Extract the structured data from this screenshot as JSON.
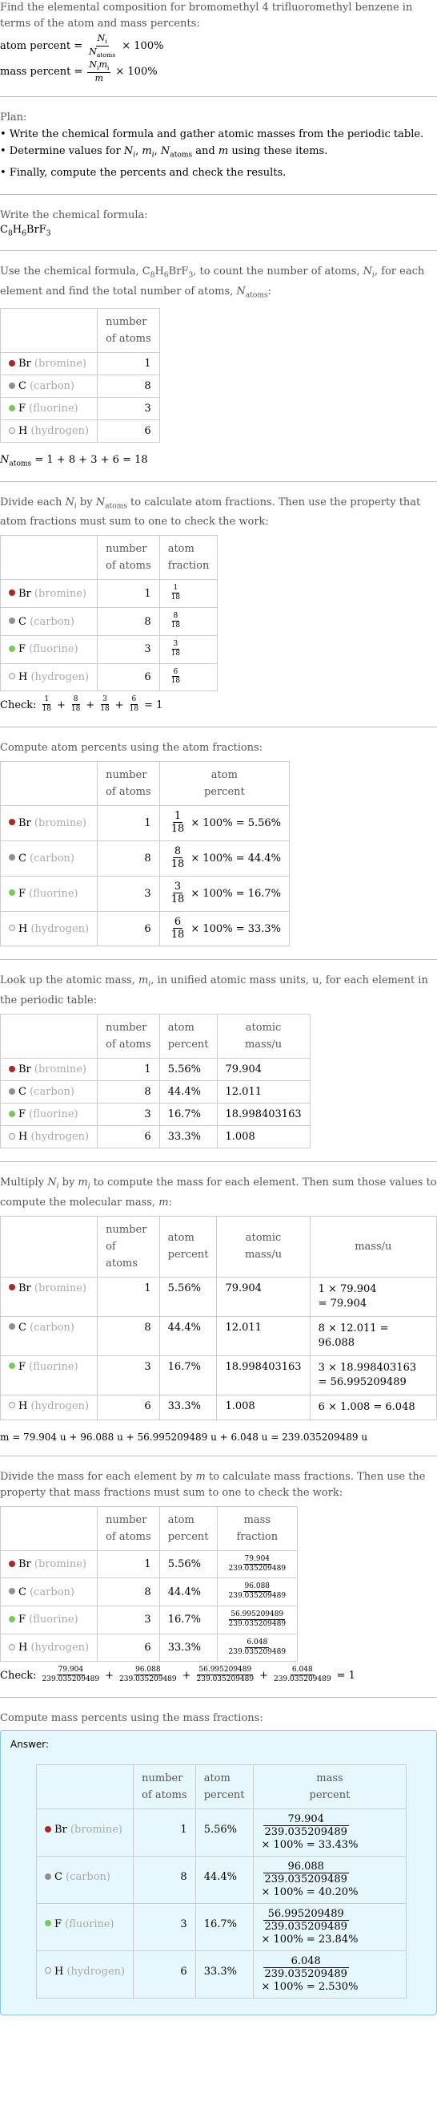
{
  "intro": {
    "text": "Find the elemental composition for bromomethyl 4 trifluoromethyl benzene in terms of the atom and mass percents:",
    "atom_percent_label": "atom percent =",
    "mass_percent_label": "mass percent =",
    "times100": "× 100%"
  },
  "plan": {
    "title": "Plan:",
    "items": [
      "Write the chemical formula and gather atomic masses from the periodic table.",
      "Determine values for Nᵢ, mᵢ, N_atoms and m using these items.",
      "Finally, compute the percents and check the results."
    ]
  },
  "formula_step": {
    "text": "Write the chemical formula:",
    "formula": "C8H6BrF3"
  },
  "elements": [
    {
      "symbol": "Br",
      "name": "(bromine)",
      "color": "#a52a2a",
      "atoms": "1",
      "frac_num": "1",
      "frac_den": "18",
      "atom_percent": "5.56%",
      "atomic_mass": "79.904",
      "mass_calc": "1 × 79.904",
      "mass_result": "= 79.904",
      "mass": "79.904",
      "mass_percent": "× 100% = 33.43%"
    },
    {
      "symbol": "C",
      "name": "(carbon)",
      "color": "#909090",
      "atoms": "8",
      "frac_num": "8",
      "frac_den": "18",
      "atom_percent": "44.4%",
      "atomic_mass": "12.011",
      "mass_calc": "8 × 12.011 = 96.088",
      "mass_result": "",
      "mass": "96.088",
      "mass_percent": "× 100% = 40.20%"
    },
    {
      "symbol": "F",
      "name": "(fluorine)",
      "color": "#7dc75d",
      "atoms": "3",
      "frac_num": "3",
      "frac_den": "18",
      "atom_percent": "16.7%",
      "atomic_mass": "18.998403163",
      "mass_calc": "3 × 18.998403163",
      "mass_result": "= 56.995209489",
      "mass": "56.995209489",
      "mass_percent": "× 100% = 23.84%"
    },
    {
      "symbol": "H",
      "name": "(hydrogen)",
      "color": "#e8f8fc",
      "atoms": "6",
      "frac_num": "6",
      "frac_den": "18",
      "atom_percent": "33.3%",
      "atomic_mass": "1.008",
      "mass_calc": "6 × 1.008 = 6.048",
      "mass_result": "",
      "mass": "6.048",
      "mass_percent": "× 100% = 2.530%"
    }
  ],
  "step_count": {
    "text_a": "Use the chemical formula, C8H6BrF3, to count the number of atoms, Nᵢ, for each element and find the total number of atoms, N_atoms:",
    "sum": "= 1 + 8 + 3 + 6 = 18"
  },
  "step_fraction": {
    "text": "Divide each Nᵢ by N_atoms to calculate atom fractions. Then use the property that atom fractions must sum to one to check the work:",
    "check_label": "Check:",
    "check_result": "= 1"
  },
  "step_atom_percent": {
    "text": "Compute atom percents using the atom fractions:"
  },
  "step_lookup": {
    "text": "Look up the atomic mass, mᵢ, in unified atomic mass units, u, for each element in the periodic table:"
  },
  "step_multiply": {
    "text": "Multiply Nᵢ by mᵢ to compute the mass for each element. Then sum those values to compute the molecular mass, m:",
    "sum": "m = 79.904 u + 96.088 u + 56.995209489 u + 6.048 u = 239.035209489 u"
  },
  "step_mass_fraction": {
    "text": "Divide the mass for each element by m to calculate mass fractions. Then use the property that mass fractions must sum to one to check the work:",
    "check_label": "Check:",
    "check_result": "= 1",
    "denominator": "239.035209489"
  },
  "step_mass_percent": {
    "text": "Compute mass percents using the mass fractions:",
    "answer_label": "Answer:"
  },
  "headers": {
    "number_of_atoms": [
      "number",
      "of atoms"
    ],
    "atom_fraction": [
      "atom",
      "fraction"
    ],
    "atom_percent": [
      "atom",
      "percent"
    ],
    "atomic_mass": [
      "atomic",
      "mass/u"
    ],
    "mass": "mass/u",
    "mass_fraction": [
      "mass",
      "fraction"
    ],
    "mass_percent": [
      "mass",
      "percent"
    ]
  }
}
